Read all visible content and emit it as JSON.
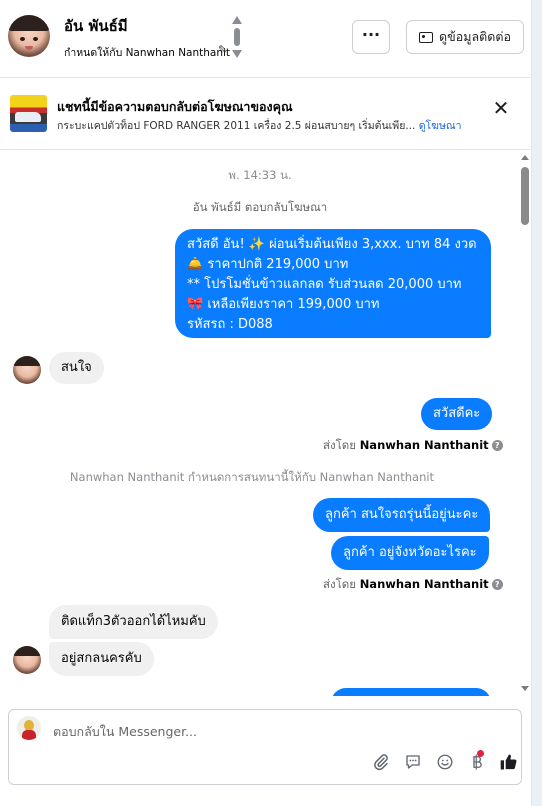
{
  "header": {
    "name": "อัน พันธ์มี",
    "assigned_to": "กำหนดให้กับ Nanwhan Nanthanit",
    "more_label": "···",
    "contact_label": "ดูข้อมูลติดต่อ"
  },
  "ad_banner": {
    "title": "แชทนี้มีข้อความตอบกลับต่อโฆษณาของคุณ",
    "description": "กระบะแคปตัวท็อป FORD RANGER 2011 เครื่อง 2.5 ผ่อนสบายๆ เริ่มต้นเพีย...",
    "link": "ดูโฆษณา",
    "close": "✕"
  },
  "chat": {
    "timestamp": "พ. 14:33 น.",
    "reply_note": "อัน พันธ์มี ตอบกลับโฆษณา",
    "promo_lines": [
      "สวัสดี อัน! ✨  ผ่อนเริ่มต้นเพียง 3,xxx. บาท 84 งวด",
      "🛎️ ราคาปกติ 219,000 บาท",
      "** โปรโมชั่นข้าวแลกลด รับส่วนลด 20,000 บาท",
      "🎀  เหลือเพียงราคา 199,000 บาท",
      "รหัสรถ : D088"
    ],
    "msg_interested": "สนใจ",
    "msg_hello": "สวัสดีคะ",
    "sent_by_prefix": "ส่งโดย",
    "sent_by_name": "Nanwhan Nanthanit",
    "system_note": "Nanwhan Nanthanit กำหนดการสนทนานี้ให้กับ Nanwhan Nanthanit",
    "msg_q1": "ลูกค้า สนใจรถรุ่นนี้อยู่นะคะ",
    "msg_q2": "ลูกค้า อยู่จังหวัดอะไรคะ",
    "msg_plate": "ติดแท็ก3ตัวออกได้ไหมคับ",
    "msg_location": "อยู่สกลนครคับ"
  },
  "composer": {
    "placeholder": "ตอบกลับใน Messenger...",
    "icons": [
      "paperclip-icon",
      "quick-reply-icon",
      "emoji-icon",
      "baht-icon",
      "thumbs-up-icon"
    ]
  },
  "colors": {
    "outgoing_bubble": "#0a7cff",
    "incoming_bubble": "#f0f0f0",
    "link": "#1664d9"
  }
}
